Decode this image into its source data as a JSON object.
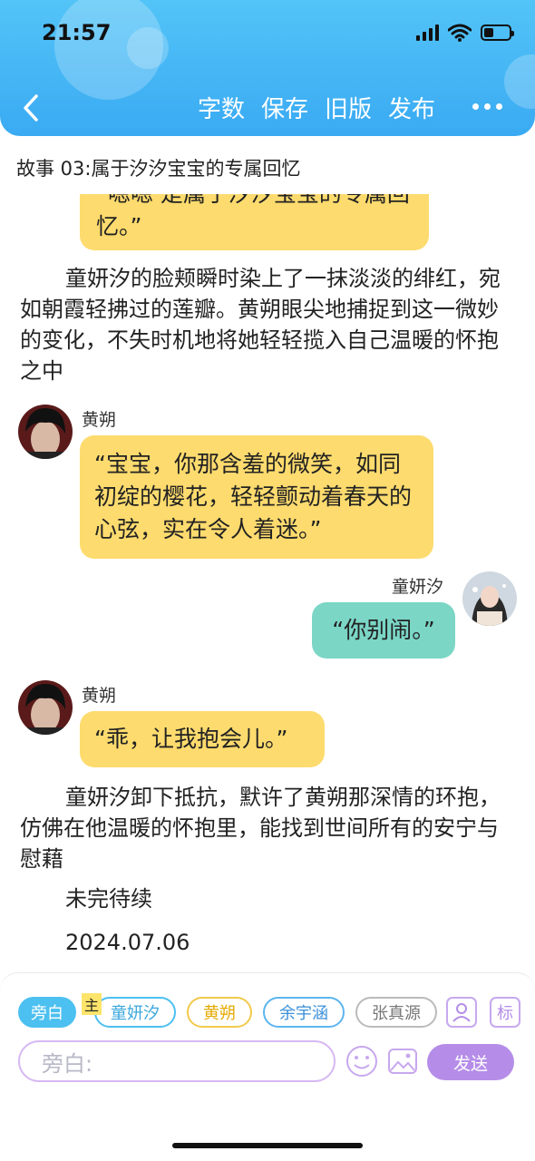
{
  "status": {
    "time": "21:57"
  },
  "nav": {
    "actions": [
      "字数",
      "保存",
      "旧版",
      "发布"
    ]
  },
  "story": {
    "title": "故事 03:属于汐汐宝宝的专属回忆"
  },
  "chat": {
    "cutoff_bubble": "“嗯嗯 是属于汐汐宝宝的专属回忆。”",
    "narration1": "童妍汐的脸颊瞬时染上了一抹淡淡的绯红，宛如朝霞轻拂过的莲瓣。黄朔眼尖地捕捉到这一微妙的变化，不失时机地将她轻轻揽入自己温暖的怀抱之中",
    "msg1": {
      "name": "黄朔",
      "text": "“宝宝，你那含羞的微笑，如同初绽的樱花，轻轻颤动着春天的心弦，实在令人着迷。”"
    },
    "msg2": {
      "name": "童妍汐",
      "text": "“你别闹。”"
    },
    "msg3": {
      "name": "黄朔",
      "text": "“乖，让我抱会儿。”"
    },
    "narration2": "童妍汐卸下抵抗，默许了黄朔那深情的环抱，仿佛在他温暖的怀抱里，能找到世间所有的安宁与慰藉",
    "ending": "未完待续",
    "date": "2024.07.06"
  },
  "composer": {
    "chips": [
      "旁白",
      "童妍汐",
      "黄朔",
      "余宇涵",
      "张真源"
    ],
    "main_badge": "主",
    "mark_label": "标",
    "input_placeholder": "旁白:",
    "send_label": "发送"
  },
  "colors": {
    "header": "#3aaaf3",
    "yellow_bubble": "#fddb6e",
    "green_bubble": "#7bd6c6",
    "accent_purple": "#b58de8"
  }
}
